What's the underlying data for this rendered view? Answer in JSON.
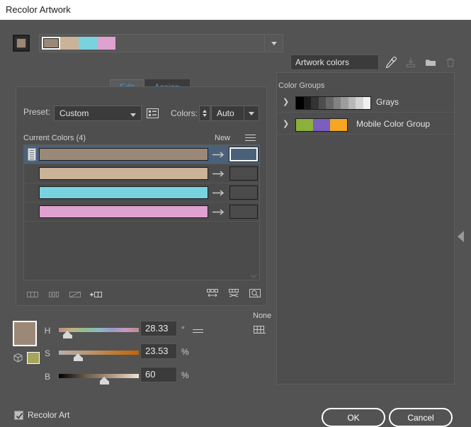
{
  "window": {
    "title": "Recolor Artwork"
  },
  "top_strip": {
    "swatch_color": "#9c8876",
    "colors": [
      "#9c8876",
      "#cbb398",
      "#79d3df",
      "#dfa1cf"
    ],
    "selected_index": 0,
    "dropdown_icon": "chevron-down-icon"
  },
  "tabs": [
    {
      "label": "Edit",
      "active": false
    },
    {
      "label": "Assign",
      "active": true
    }
  ],
  "edit_panel": {
    "preset_label": "Preset:",
    "preset_value": "Custom",
    "preset_options": [
      "Custom"
    ],
    "list_icon": "color-list-icon",
    "colors_label": "Colors:",
    "colors_value": "Auto",
    "colors_options": [
      "Auto"
    ],
    "current_colors_label": "Current Colors (4)",
    "new_label": "New",
    "menu_icon": "panel-menu-icon",
    "color_rows": [
      {
        "source": "#9c8876",
        "target": "#9c8876",
        "selected": true
      },
      {
        "source": "#cbb398",
        "target": "#cbb398",
        "selected": false
      },
      {
        "source": "#79d3df",
        "target": "#79d3df",
        "selected": false
      },
      {
        "source": "#dfa1cf",
        "target": "#dfa1cf",
        "selected": false
      }
    ],
    "left_tools": [
      "merge-colors-icon",
      "separate-colors-icon",
      "exclude-color-icon",
      "add-row-icon"
    ],
    "right_tools": [
      "randomize-order-icon",
      "randomize-saturation-icon",
      "color-reduction-options-icon"
    ]
  },
  "hsb": {
    "preview_color": "#9c8876",
    "cube_icon": "color-mode-cube-icon",
    "secondary_swatch": "#a3a65b",
    "sliders": [
      {
        "name": "H",
        "value": "28.33",
        "unit": "°",
        "pos": 11
      },
      {
        "name": "S",
        "value": "23.53",
        "unit": "%",
        "pos": 24
      },
      {
        "name": "B",
        "value": "60",
        "unit": "%",
        "pos": 57
      }
    ],
    "menu_icon": "hsb-menu-icon",
    "none_label": "None",
    "grid_icon": "color-swatch-grid-icon"
  },
  "right_panel": {
    "artwork_field_value": "Artwork colors",
    "tool_icons": [
      "eyedropper-icon",
      "save-swatches-icon",
      "new-color-group-icon",
      "delete-icon"
    ],
    "color_groups_label": "Color Groups",
    "groups": [
      {
        "name": "Grays",
        "chevron": "chevron-right-icon",
        "swatches": [
          "#000000",
          "#1b1b1b",
          "#333333",
          "#4d4d4d",
          "#676767",
          "#828282",
          "#9d9d9d",
          "#b8b8b8",
          "#d4d4d4",
          "#f0f0f0"
        ]
      },
      {
        "name": "Mobile Color Group",
        "chevron": "chevron-right-icon",
        "swatches": [
          "#8cb03c",
          "#7a5fbe",
          "#f5a623"
        ]
      }
    ],
    "collapse_icon": "collapse-panel-icon"
  },
  "footer": {
    "recolor_art_label": "Recolor Art",
    "recolor_art_checked": true,
    "ok_label": "OK",
    "cancel_label": "Cancel"
  }
}
